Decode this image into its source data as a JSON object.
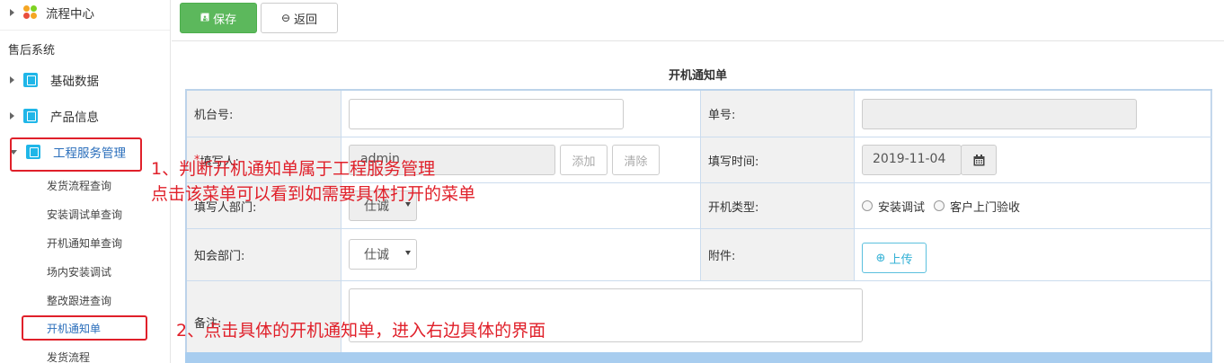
{
  "sidebar": {
    "flow_center": "流程中心",
    "section_title": "售后系统",
    "groups": [
      {
        "label": "基础数据"
      },
      {
        "label": "产品信息"
      },
      {
        "label": "工程服务管理"
      }
    ],
    "sub_items": [
      {
        "label": "发货流程查询"
      },
      {
        "label": "安装调试单查询"
      },
      {
        "label": "开机通知单查询"
      },
      {
        "label": "场内安装调试"
      },
      {
        "label": "整改跟进查询"
      },
      {
        "label": "开机通知单"
      },
      {
        "label": "发货流程"
      }
    ]
  },
  "toolbar": {
    "save_label": "保存",
    "back_label": "返回"
  },
  "form": {
    "title": "开机通知单",
    "machine_no_label": "机台号:",
    "machine_no_value": "",
    "order_no_label": "单号:",
    "order_no_value": "",
    "filler_required": "*",
    "filler_label": "填写人:",
    "filler_value": "admin",
    "add_label": "添加",
    "clear_label": "清除",
    "fill_time_label": "填写时间:",
    "fill_time_value": "2019-11-04",
    "filler_dept_label": "填写人部门:",
    "filler_dept_value": "仕诚",
    "startup_type_label": "开机类型:",
    "startup_type_options": [
      "安装调试",
      "客户上门验收"
    ],
    "notify_dept_label": "知会部门:",
    "notify_dept_value": "仕诚",
    "attachment_label": "附件:",
    "upload_label": "上传",
    "remarks_label": "备注:",
    "remarks_value": ""
  },
  "annotations": {
    "note1_line1": "1、判断开机通知单属于工程服务管理",
    "note1_line2": "点击该菜单可以看到如需要具体打开的菜单",
    "note2": "2、点击具体的开机通知单，进入右边具体的界面"
  },
  "colors": {
    "save_button": "#5cb85c",
    "annotation": "#e0202a",
    "sidebar_icon": "#1fb6e8",
    "table_border": "#bcd3ea"
  }
}
